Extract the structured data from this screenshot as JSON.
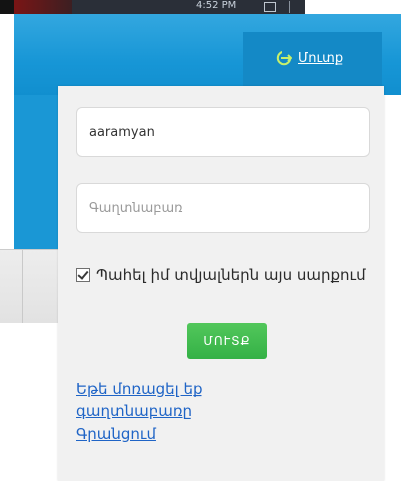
{
  "taskbar": {
    "time": "4:52 PM"
  },
  "header": {
    "login_link": "Մուտք"
  },
  "form": {
    "username_value": "aaramyan",
    "password_placeholder": "Գաղտնաբառ",
    "remember_label": "Պահել իմ տվյալներն այս սարքում",
    "remember_checked": true,
    "submit_label": "ՄՈՒՏՔ"
  },
  "links": {
    "forgot_password": "Եթե մոռացել եք գաղտնաբառը",
    "register": "Գրանցում"
  },
  "colors": {
    "header_blue": "#1796d6",
    "submit_green": "#34b146",
    "link_blue": "#1f64c6"
  }
}
